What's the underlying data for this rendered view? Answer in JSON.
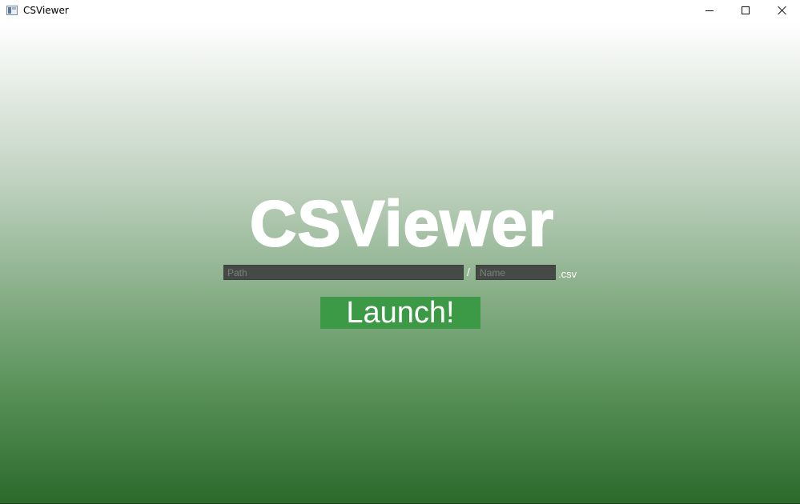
{
  "window": {
    "title": "CSViewer",
    "controls": {
      "minimize": "minimize-icon",
      "maximize": "maximize-icon",
      "close": "close-icon"
    }
  },
  "main": {
    "app_name": "CSViewer",
    "path_input": {
      "placeholder": "Path",
      "value": ""
    },
    "separator": "/",
    "name_input": {
      "placeholder": "Name",
      "value": ""
    },
    "extension": ".csv",
    "launch_label": "Launch!"
  },
  "colors": {
    "gradient_top": "#ffffff",
    "gradient_bottom": "#2b6a2b",
    "input_background": "#464a46",
    "button_background": "#3c9a46",
    "text_light": "#ffffff"
  }
}
